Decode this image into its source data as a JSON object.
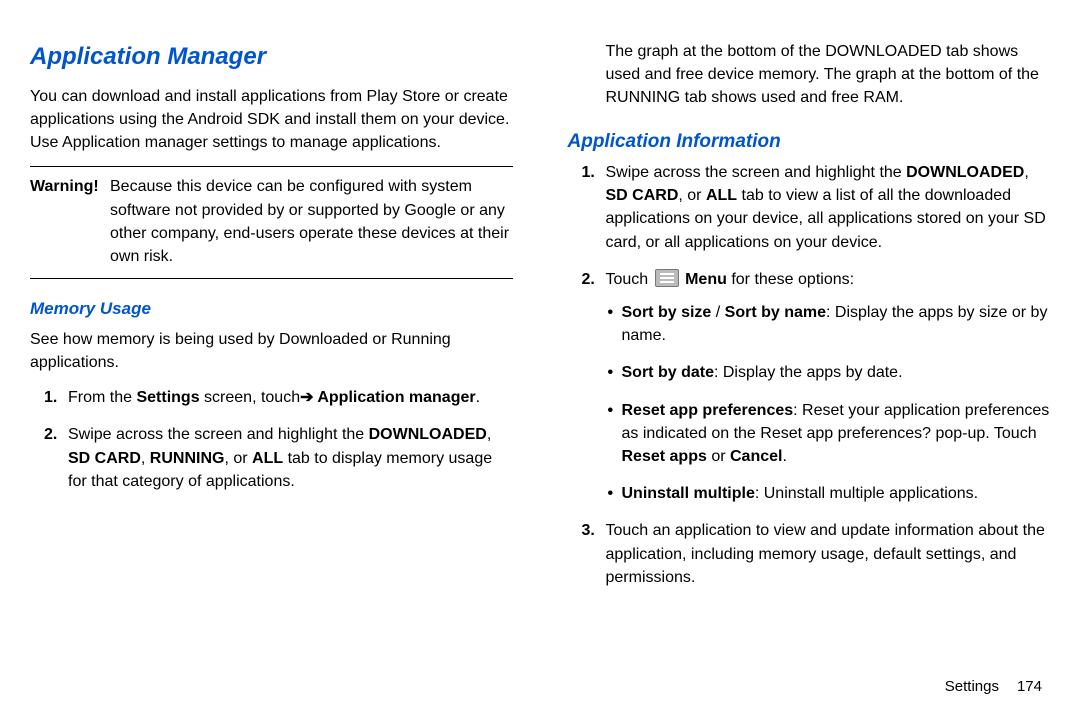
{
  "left": {
    "heading": "Application Manager",
    "intro": "You can download and install applications from Play Store or create applications using the Android SDK and install them on your device. Use Application manager settings to manage applications.",
    "warning_lead": "Warning!",
    "warning_body": "Because this device can be configured with system software not provided by or supported by Google or any other company, end-users operate these devices at their own risk.",
    "sub_memory": "Memory Usage",
    "memory_intro": "See how memory is being used by Downloaded or Running applications.",
    "step1_a": "From the ",
    "step1_b": "Settings",
    "step1_c": " screen, touch",
    "arrow": "➔",
    "step1_d": " Application manager",
    "step1_e": ".",
    "step2_a": "Swipe across the screen and highlight the ",
    "step2_b": "DOWNLOADED",
    "step2_c": ", ",
    "step2_d": "SD CARD",
    "step2_e": ", ",
    "step2_f": "RUNNING",
    "step2_g": ", or ",
    "step2_h": "ALL",
    "step2_i": " tab to display memory usage for that category of applications."
  },
  "right": {
    "top_para": "The graph at the bottom of the DOWNLOADED tab shows used and free device memory. The graph at the bottom of the RUNNING tab shows used and free RAM.",
    "sub_appinfo": "Application Information",
    "r1_a": "Swipe across the screen and highlight the ",
    "r1_b": "DOWNLOADED",
    "r1_c": ", ",
    "r1_d": "SD CARD",
    "r1_e": ", or ",
    "r1_f": "ALL",
    "r1_g": " tab to view a list of all the downloaded applications on your device, all applications stored on your SD card, or all applications on your device.",
    "r2_a": "Touch ",
    "r2_menu": "Menu",
    "r2_b": " for these options:",
    "b1_a": "Sort by size",
    "b1_s": " / ",
    "b1_b": "Sort by name",
    "b1_c": ": Display the apps by size or by name.",
    "b2_a": "Sort by date",
    "b2_b": ": Display the apps by date.",
    "b3_a": "Reset app preferences",
    "b3_b": ": Reset your application preferences as indicated on the Reset app preferences? pop-up. Touch ",
    "b3_c": "Reset apps",
    "b3_d": " or ",
    "b3_e": "Cancel",
    "b3_f": ".",
    "b4_a": "Uninstall multiple",
    "b4_b": ": Uninstall multiple applications.",
    "r3": "Touch an application to view and update information about the application, including memory usage, default settings, and permissions."
  },
  "footer": {
    "label": "Settings",
    "page": "174"
  }
}
